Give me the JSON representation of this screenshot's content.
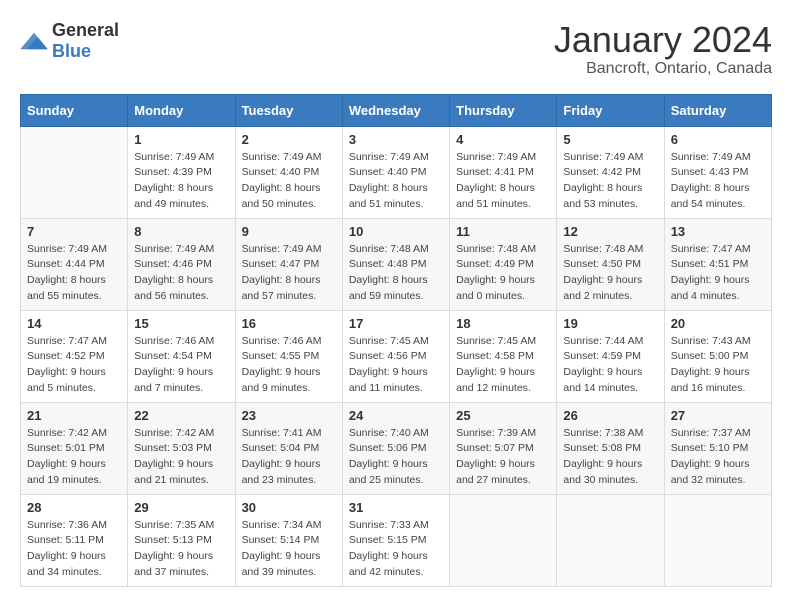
{
  "header": {
    "logo_general": "General",
    "logo_blue": "Blue",
    "month_title": "January 2024",
    "location": "Bancroft, Ontario, Canada"
  },
  "days_of_week": [
    "Sunday",
    "Monday",
    "Tuesday",
    "Wednesday",
    "Thursday",
    "Friday",
    "Saturday"
  ],
  "weeks": [
    [
      {
        "day": "",
        "empty": true
      },
      {
        "day": "1",
        "sunrise": "Sunrise: 7:49 AM",
        "sunset": "Sunset: 4:39 PM",
        "daylight": "Daylight: 8 hours and 49 minutes."
      },
      {
        "day": "2",
        "sunrise": "Sunrise: 7:49 AM",
        "sunset": "Sunset: 4:40 PM",
        "daylight": "Daylight: 8 hours and 50 minutes."
      },
      {
        "day": "3",
        "sunrise": "Sunrise: 7:49 AM",
        "sunset": "Sunset: 4:40 PM",
        "daylight": "Daylight: 8 hours and 51 minutes."
      },
      {
        "day": "4",
        "sunrise": "Sunrise: 7:49 AM",
        "sunset": "Sunset: 4:41 PM",
        "daylight": "Daylight: 8 hours and 51 minutes."
      },
      {
        "day": "5",
        "sunrise": "Sunrise: 7:49 AM",
        "sunset": "Sunset: 4:42 PM",
        "daylight": "Daylight: 8 hours and 53 minutes."
      },
      {
        "day": "6",
        "sunrise": "Sunrise: 7:49 AM",
        "sunset": "Sunset: 4:43 PM",
        "daylight": "Daylight: 8 hours and 54 minutes."
      }
    ],
    [
      {
        "day": "7",
        "sunrise": "Sunrise: 7:49 AM",
        "sunset": "Sunset: 4:44 PM",
        "daylight": "Daylight: 8 hours and 55 minutes."
      },
      {
        "day": "8",
        "sunrise": "Sunrise: 7:49 AM",
        "sunset": "Sunset: 4:46 PM",
        "daylight": "Daylight: 8 hours and 56 minutes."
      },
      {
        "day": "9",
        "sunrise": "Sunrise: 7:49 AM",
        "sunset": "Sunset: 4:47 PM",
        "daylight": "Daylight: 8 hours and 57 minutes."
      },
      {
        "day": "10",
        "sunrise": "Sunrise: 7:48 AM",
        "sunset": "Sunset: 4:48 PM",
        "daylight": "Daylight: 8 hours and 59 minutes."
      },
      {
        "day": "11",
        "sunrise": "Sunrise: 7:48 AM",
        "sunset": "Sunset: 4:49 PM",
        "daylight": "Daylight: 9 hours and 0 minutes."
      },
      {
        "day": "12",
        "sunrise": "Sunrise: 7:48 AM",
        "sunset": "Sunset: 4:50 PM",
        "daylight": "Daylight: 9 hours and 2 minutes."
      },
      {
        "day": "13",
        "sunrise": "Sunrise: 7:47 AM",
        "sunset": "Sunset: 4:51 PM",
        "daylight": "Daylight: 9 hours and 4 minutes."
      }
    ],
    [
      {
        "day": "14",
        "sunrise": "Sunrise: 7:47 AM",
        "sunset": "Sunset: 4:52 PM",
        "daylight": "Daylight: 9 hours and 5 minutes."
      },
      {
        "day": "15",
        "sunrise": "Sunrise: 7:46 AM",
        "sunset": "Sunset: 4:54 PM",
        "daylight": "Daylight: 9 hours and 7 minutes."
      },
      {
        "day": "16",
        "sunrise": "Sunrise: 7:46 AM",
        "sunset": "Sunset: 4:55 PM",
        "daylight": "Daylight: 9 hours and 9 minutes."
      },
      {
        "day": "17",
        "sunrise": "Sunrise: 7:45 AM",
        "sunset": "Sunset: 4:56 PM",
        "daylight": "Daylight: 9 hours and 11 minutes."
      },
      {
        "day": "18",
        "sunrise": "Sunrise: 7:45 AM",
        "sunset": "Sunset: 4:58 PM",
        "daylight": "Daylight: 9 hours and 12 minutes."
      },
      {
        "day": "19",
        "sunrise": "Sunrise: 7:44 AM",
        "sunset": "Sunset: 4:59 PM",
        "daylight": "Daylight: 9 hours and 14 minutes."
      },
      {
        "day": "20",
        "sunrise": "Sunrise: 7:43 AM",
        "sunset": "Sunset: 5:00 PM",
        "daylight": "Daylight: 9 hours and 16 minutes."
      }
    ],
    [
      {
        "day": "21",
        "sunrise": "Sunrise: 7:42 AM",
        "sunset": "Sunset: 5:01 PM",
        "daylight": "Daylight: 9 hours and 19 minutes."
      },
      {
        "day": "22",
        "sunrise": "Sunrise: 7:42 AM",
        "sunset": "Sunset: 5:03 PM",
        "daylight": "Daylight: 9 hours and 21 minutes."
      },
      {
        "day": "23",
        "sunrise": "Sunrise: 7:41 AM",
        "sunset": "Sunset: 5:04 PM",
        "daylight": "Daylight: 9 hours and 23 minutes."
      },
      {
        "day": "24",
        "sunrise": "Sunrise: 7:40 AM",
        "sunset": "Sunset: 5:06 PM",
        "daylight": "Daylight: 9 hours and 25 minutes."
      },
      {
        "day": "25",
        "sunrise": "Sunrise: 7:39 AM",
        "sunset": "Sunset: 5:07 PM",
        "daylight": "Daylight: 9 hours and 27 minutes."
      },
      {
        "day": "26",
        "sunrise": "Sunrise: 7:38 AM",
        "sunset": "Sunset: 5:08 PM",
        "daylight": "Daylight: 9 hours and 30 minutes."
      },
      {
        "day": "27",
        "sunrise": "Sunrise: 7:37 AM",
        "sunset": "Sunset: 5:10 PM",
        "daylight": "Daylight: 9 hours and 32 minutes."
      }
    ],
    [
      {
        "day": "28",
        "sunrise": "Sunrise: 7:36 AM",
        "sunset": "Sunset: 5:11 PM",
        "daylight": "Daylight: 9 hours and 34 minutes."
      },
      {
        "day": "29",
        "sunrise": "Sunrise: 7:35 AM",
        "sunset": "Sunset: 5:13 PM",
        "daylight": "Daylight: 9 hours and 37 minutes."
      },
      {
        "day": "30",
        "sunrise": "Sunrise: 7:34 AM",
        "sunset": "Sunset: 5:14 PM",
        "daylight": "Daylight: 9 hours and 39 minutes."
      },
      {
        "day": "31",
        "sunrise": "Sunrise: 7:33 AM",
        "sunset": "Sunset: 5:15 PM",
        "daylight": "Daylight: 9 hours and 42 minutes."
      },
      {
        "day": "",
        "empty": true
      },
      {
        "day": "",
        "empty": true
      },
      {
        "day": "",
        "empty": true
      }
    ]
  ]
}
